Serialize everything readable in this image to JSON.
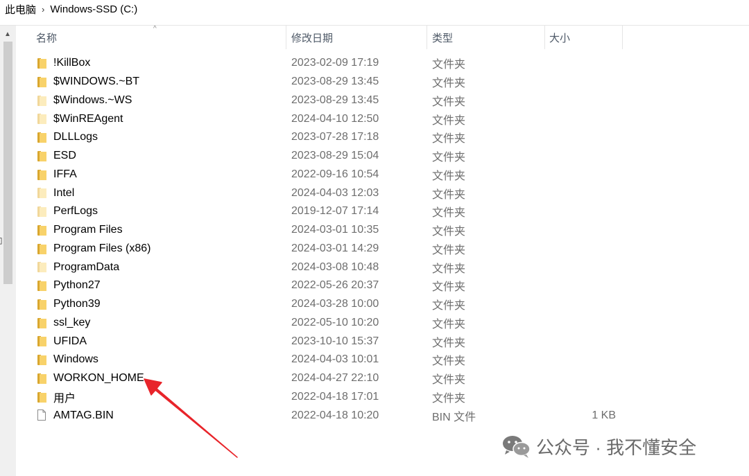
{
  "breadcrumb": {
    "root": "此电脑",
    "sep": "›",
    "drive": "Windows-SSD (C:)"
  },
  "columns": {
    "name": "名称",
    "date": "修改日期",
    "type": "类型",
    "size": "大小"
  },
  "files": [
    {
      "name": "!KillBox",
      "date": "2023-02-09 17:19",
      "type": "文件夹",
      "size": "",
      "icon": "folder-icon"
    },
    {
      "name": "$WINDOWS.~BT",
      "date": "2023-08-29 13:45",
      "type": "文件夹",
      "size": "",
      "icon": "folder-icon"
    },
    {
      "name": "$Windows.~WS",
      "date": "2023-08-29 13:45",
      "type": "文件夹",
      "size": "",
      "icon": "folder-hidden-icon"
    },
    {
      "name": "$WinREAgent",
      "date": "2024-04-10 12:50",
      "type": "文件夹",
      "size": "",
      "icon": "folder-hidden-icon"
    },
    {
      "name": "DLLLogs",
      "date": "2023-07-28 17:18",
      "type": "文件夹",
      "size": "",
      "icon": "folder-icon"
    },
    {
      "name": "ESD",
      "date": "2023-08-29 15:04",
      "type": "文件夹",
      "size": "",
      "icon": "folder-icon"
    },
    {
      "name": "IFFA",
      "date": "2022-09-16 10:54",
      "type": "文件夹",
      "size": "",
      "icon": "folder-icon"
    },
    {
      "name": "Intel",
      "date": "2024-04-03 12:03",
      "type": "文件夹",
      "size": "",
      "icon": "folder-hidden-icon"
    },
    {
      "name": "PerfLogs",
      "date": "2019-12-07 17:14",
      "type": "文件夹",
      "size": "",
      "icon": "folder-hidden-icon"
    },
    {
      "name": "Program Files",
      "date": "2024-03-01 10:35",
      "type": "文件夹",
      "size": "",
      "icon": "folder-icon"
    },
    {
      "name": "Program Files (x86)",
      "date": "2024-03-01 14:29",
      "type": "文件夹",
      "size": "",
      "icon": "folder-icon"
    },
    {
      "name": "ProgramData",
      "date": "2024-03-08 10:48",
      "type": "文件夹",
      "size": "",
      "icon": "folder-hidden-icon"
    },
    {
      "name": "Python27",
      "date": "2022-05-26 20:37",
      "type": "文件夹",
      "size": "",
      "icon": "folder-icon"
    },
    {
      "name": "Python39",
      "date": "2024-03-28 10:00",
      "type": "文件夹",
      "size": "",
      "icon": "folder-icon"
    },
    {
      "name": "ssl_key",
      "date": "2022-05-10 10:20",
      "type": "文件夹",
      "size": "",
      "icon": "folder-icon"
    },
    {
      "name": "UFIDA",
      "date": "2023-10-10 15:37",
      "type": "文件夹",
      "size": "",
      "icon": "folder-icon"
    },
    {
      "name": "Windows",
      "date": "2024-04-03 10:01",
      "type": "文件夹",
      "size": "",
      "icon": "folder-icon"
    },
    {
      "name": "WORKON_HOME",
      "date": "2024-04-27 22:10",
      "type": "文件夹",
      "size": "",
      "icon": "folder-icon"
    },
    {
      "name": "用户",
      "date": "2022-04-18 17:01",
      "type": "文件夹",
      "size": "",
      "icon": "folder-icon"
    },
    {
      "name": "AMTAG.BIN",
      "date": "2022-04-18 10:20",
      "type": "BIN 文件",
      "size": "1 KB",
      "icon": "file-icon"
    }
  ],
  "watermark": {
    "text": "公众号 · 我不懂安全",
    "icon": "wechat-logo-icon"
  },
  "annotation": {
    "icon": "red-arrow-icon",
    "color": "#e8242a",
    "points_to": "WORKON_HOME"
  }
}
